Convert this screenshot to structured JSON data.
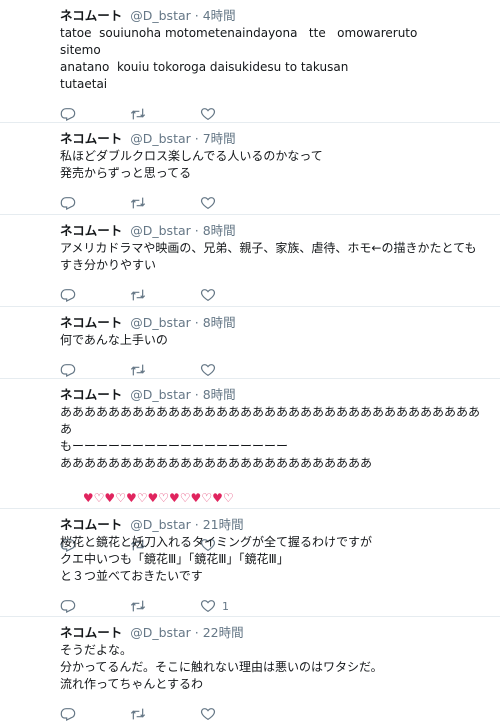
{
  "tweets": [
    {
      "name": "ネコムート",
      "handle": "@D_bstar",
      "dot": "·",
      "time": "4時間",
      "text": "tatoe  souiunoha motometenaindayona   tte   omowareruto\nsitemo\nanatano  kouiu tokoroga daisukidesu to takusan\ntutaetai",
      "like_count": ""
    },
    {
      "name": "ネコムート",
      "handle": "@D_bstar",
      "dot": "·",
      "time": "7時間",
      "text": "私ほどダブルクロス楽しんでる人いるのかなって\n発売からずっと思ってる",
      "like_count": ""
    },
    {
      "name": "ネコムート",
      "handle": "@D_bstar",
      "dot": "·",
      "time": "8時間",
      "text": "アメリカドラマや映画の、兄弟、親子、家族、虐待、ホモ←の描きかたとてもすき分かりやすい",
      "like_count": ""
    },
    {
      "name": "ネコムート",
      "handle": "@D_bstar",
      "dot": "·",
      "time": "8時間",
      "text": "何であんな上手いの",
      "like_count": ""
    },
    {
      "name": "ネコムート",
      "handle": "@D_bstar",
      "dot": "·",
      "time": "8時間",
      "text": "ああああああああああああああああああああああああああああああああああああ\nもーーーーーーーーーーーーーーーーーー\nああああああああああああああああああああああああああ",
      "hearts": [
        "♥",
        "♡",
        "♥",
        "♡",
        "♥",
        "♡",
        "♥",
        "♡",
        "♥",
        "♡",
        "♥",
        "♡",
        "♥",
        "♡"
      ],
      "like_count": ""
    },
    {
      "name": "ネコムート",
      "handle": "@D_bstar",
      "dot": "·",
      "time": "21時間",
      "text": "桜花と鏡花と妖刀入れるタイミングが全て握るわけですが\nクエ中いつも「鏡花Ⅲ」「鏡花Ⅲ」「鏡花Ⅲ」\nと３つ並べておきたいです",
      "like_count": "1"
    },
    {
      "name": "ネコムート",
      "handle": "@D_bstar",
      "dot": "·",
      "time": "22時間",
      "text": "そうだよな。\n分かってるんだ。そこに触れない理由は悪いのはワタシだ。\n流れ作ってちゃんとするわ",
      "like_count": ""
    }
  ],
  "icons": {
    "reply": "reply-icon",
    "retweet": "retweet-icon",
    "like": "heart-icon"
  },
  "colors": {
    "text": "#14171a",
    "muted": "#657786",
    "border": "#e6ecf0",
    "heart": "#e0245e"
  }
}
